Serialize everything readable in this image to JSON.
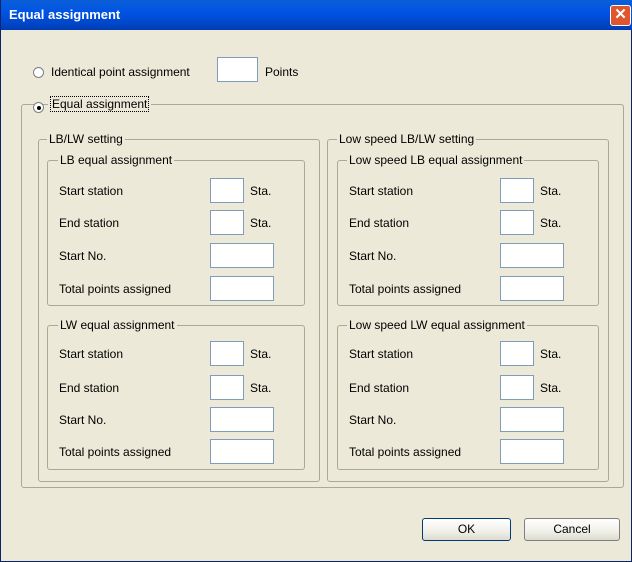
{
  "window": {
    "title": "Equal assignment",
    "close_glyph": "✕"
  },
  "mode": {
    "identical_label": "Identical point assignment",
    "identical_points_value": "",
    "points_label": "Points",
    "equal_label": "Equal assignment",
    "selected": "equal"
  },
  "lblw": {
    "title": "LB/LW setting",
    "lb": {
      "title": "LB equal assignment",
      "start_station_label": "Start station",
      "start_station_value": "",
      "sta1": "Sta.",
      "end_station_label": "End station",
      "end_station_value": "",
      "sta2": "Sta.",
      "start_no_label": "Start No.",
      "start_no_value": "",
      "total_label": "Total points assigned",
      "total_value": ""
    },
    "lw": {
      "title": "LW equal assignment",
      "start_station_label": "Start station",
      "start_station_value": "",
      "sta1": "Sta.",
      "end_station_label": "End station",
      "end_station_value": "",
      "sta2": "Sta.",
      "start_no_label": "Start No.",
      "start_no_value": "",
      "total_label": "Total points assigned",
      "total_value": ""
    }
  },
  "low": {
    "title": "Low speed LB/LW setting",
    "lb": {
      "title": "Low speed LB equal assignment",
      "start_station_label": "Start station",
      "start_station_value": "",
      "sta1": "Sta.",
      "end_station_label": "End station",
      "end_station_value": "",
      "sta2": "Sta.",
      "start_no_label": "Start No.",
      "start_no_value": "",
      "total_label": "Total points assigned",
      "total_value": ""
    },
    "lw": {
      "title": "Low speed LW equal assignment",
      "start_station_label": "Start station",
      "start_station_value": "",
      "sta1": "Sta.",
      "end_station_label": "End station",
      "end_station_value": "",
      "sta2": "Sta.",
      "start_no_label": "Start No.",
      "start_no_value": "",
      "total_label": "Total points assigned",
      "total_value": ""
    }
  },
  "buttons": {
    "ok": "OK",
    "cancel": "Cancel"
  },
  "colors": {
    "titlebar": "#0054e3",
    "close": "#e0542e",
    "face": "#ece9d8",
    "field_border": "#7f9db9"
  }
}
